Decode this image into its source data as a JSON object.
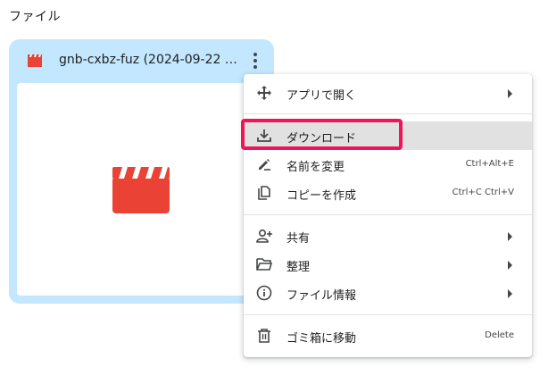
{
  "section": {
    "title": "ファイル"
  },
  "file_card": {
    "name": "gnb-cxbz-fuz (2024-09-22 …",
    "type_icon": "video-clapperboard-icon",
    "more_icon": "more-vert-icon",
    "accent_color": "#c2e7ff",
    "icon_color": "#ea4335"
  },
  "context_menu": {
    "items": [
      {
        "label": "アプリで開く",
        "icon": "open-with-icon",
        "shortcut": "",
        "submenu": true
      },
      {
        "label": "ダウンロード",
        "icon": "download-icon",
        "shortcut": "",
        "submenu": false,
        "hovered": true
      },
      {
        "label": "名前を変更",
        "icon": "rename-icon",
        "shortcut": "Ctrl+Alt+E",
        "submenu": false
      },
      {
        "label": "コピーを作成",
        "icon": "copy-icon",
        "shortcut": "Ctrl+C Ctrl+V",
        "submenu": false
      },
      {
        "label": "共有",
        "icon": "share-person-add-icon",
        "shortcut": "",
        "submenu": true
      },
      {
        "label": "整理",
        "icon": "folder-open-icon",
        "shortcut": "",
        "submenu": true
      },
      {
        "label": "ファイル情報",
        "icon": "info-icon",
        "shortcut": "",
        "submenu": true
      },
      {
        "label": "ゴミ箱に移動",
        "icon": "trash-icon",
        "shortcut": "Delete",
        "submenu": false
      }
    ]
  },
  "highlight": {
    "target": "ダウンロード",
    "color": "#f0145a"
  }
}
